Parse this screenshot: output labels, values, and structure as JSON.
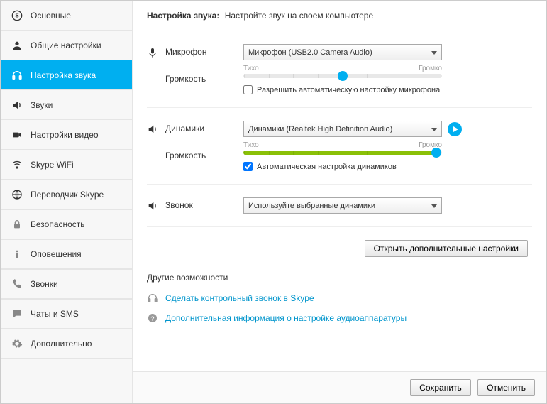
{
  "header": {
    "title": "Настройка звука:",
    "subtitle": "Настройте звук на своем компьютере"
  },
  "sidebar": {
    "items": [
      {
        "label": "Основные"
      },
      {
        "label": "Общие настройки"
      },
      {
        "label": "Настройка звука"
      },
      {
        "label": "Звуки"
      },
      {
        "label": "Настройки видео"
      },
      {
        "label": "Skype WiFi"
      },
      {
        "label": "Переводчик Skype"
      },
      {
        "label": "Безопасность"
      },
      {
        "label": "Оповещения"
      },
      {
        "label": "Звонки"
      },
      {
        "label": "Чаты и SMS"
      },
      {
        "label": "Дополнительно"
      }
    ]
  },
  "audio": {
    "mic_label": "Микрофон",
    "mic_device": "Микрофон (USB2.0 Camera Audio)",
    "volume_label": "Громкость",
    "quiet": "Тихо",
    "loud": "Громко",
    "mic_auto": "Разрешить автоматическую настройку микрофона",
    "spk_label": "Динамики",
    "spk_device": "Динамики (Realtek High Definition Audio)",
    "spk_auto": "Автоматическая настройка динамиков",
    "ring_label": "Звонок",
    "ring_device": "Используйте выбранные динамики",
    "adv_btn": "Открыть дополнительные настройки"
  },
  "other": {
    "title": "Другие возможности",
    "link1": "Сделать контрольный звонок в Skype",
    "link2": "Дополнительная информация о настройке аудиоаппаратуры"
  },
  "footer": {
    "save": "Сохранить",
    "cancel": "Отменить"
  }
}
